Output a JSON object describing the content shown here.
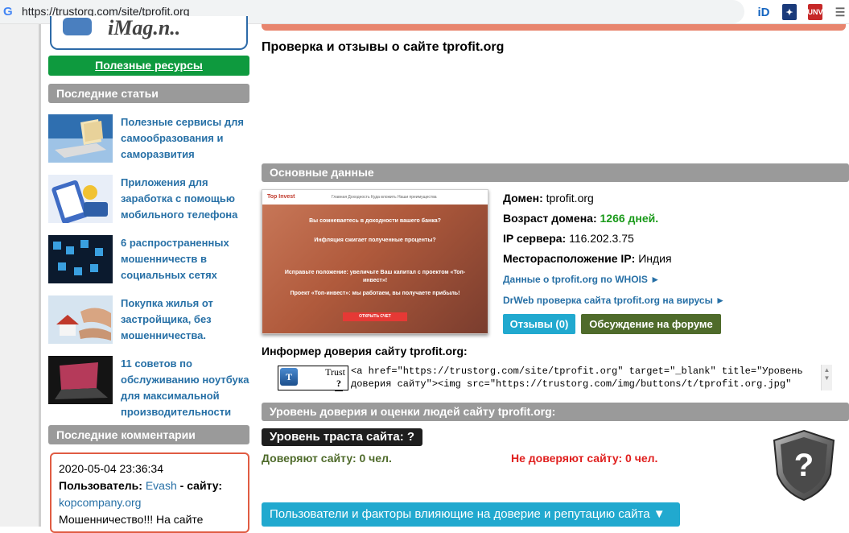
{
  "browser": {
    "url": "https://trustorg.com/site/tprofit.org",
    "ext_id_label": "iD",
    "ext3_label": "UNV",
    "menu_icon": "menu-icon"
  },
  "sidebar": {
    "logo_text": "iMag.n..",
    "useful_resources": "Полезные ресурсы",
    "recent_articles_title": "Последние статьи",
    "articles": [
      {
        "title": "Полезные сервисы для самообразования и саморазвития"
      },
      {
        "title": "Приложения для заработка с помощью мобильного телефона"
      },
      {
        "title": "6 распространенных мошенничеств в социальных сетях"
      },
      {
        "title": "Покупка жилья от застройщика, без мошенничества."
      },
      {
        "title": "11 советов по обслуживанию ноутбука для максимальной производительности"
      }
    ],
    "recent_comments_title": "Последние комментарии",
    "comment": {
      "date": "2020-05-04 23:36:34",
      "user_label": "Пользователь:",
      "user": "Evash",
      "site_label": "- сайту:",
      "site": "kopcompany.org",
      "text": "Мошенничество!!! На сайте"
    }
  },
  "main": {
    "title": "Проверка и отзывы о сайте tprofit.org",
    "basic_data_title": "Основные данные",
    "screenshot": {
      "brand": "Top Invest",
      "nav": "Главная   Доходность   Куда вложить   Наши преимущества",
      "lines": [
        "Вы сомневаетесь в доходности вашего банка?",
        "Инфляция сжигает полученные проценты?",
        "Исправьте положение: увеличьте Ваш капитал с проектом «Топ-инвест»!",
        "Проект «Топ-инвест»: мы работаем, вы получаете прибыль!"
      ],
      "button": "ОТКРЫТЬ СЧЕТ"
    },
    "domain_label": "Домен:",
    "domain_value": "tprofit.org",
    "age_label": "Возраст домена:",
    "age_value": "1266 дней.",
    "ip_label": "IP сервера:",
    "ip_value": "116.202.3.75",
    "location_label": "Месторасположение IP:",
    "location_value": "Индия",
    "whois_link": "Данные о tprofit.org по WHOIS ►",
    "drweb_link": "DrWeb проверка сайта tprofit.org на вирусы ►",
    "reviews_button": "Отзывы (0)",
    "forum_button": "Обсуждение на форуме",
    "informer_title": "Информер доверия сайту tprofit.org:",
    "badge_label": "Trust",
    "badge_value": "?",
    "informer_code": "<a href=\"https://trustorg.com/site/tprofit.org\" target=\"_blank\" title=\"Уровень доверия сайту\"><img src=\"https://trustorg.com/img/buttons/t/tprofit.org.jpg\"",
    "trust_section_title": "Уровень доверия и оценки людей сайту tprofit.org:",
    "trust_level": "Уровень траста сайта: ?",
    "trust_yes": "Доверяют сайту: 0 чел.",
    "trust_no": "Не доверяют сайту: 0 чел.",
    "users_button": "Пользователи и факторы влияющие на доверие и репутацию сайта ▼"
  }
}
